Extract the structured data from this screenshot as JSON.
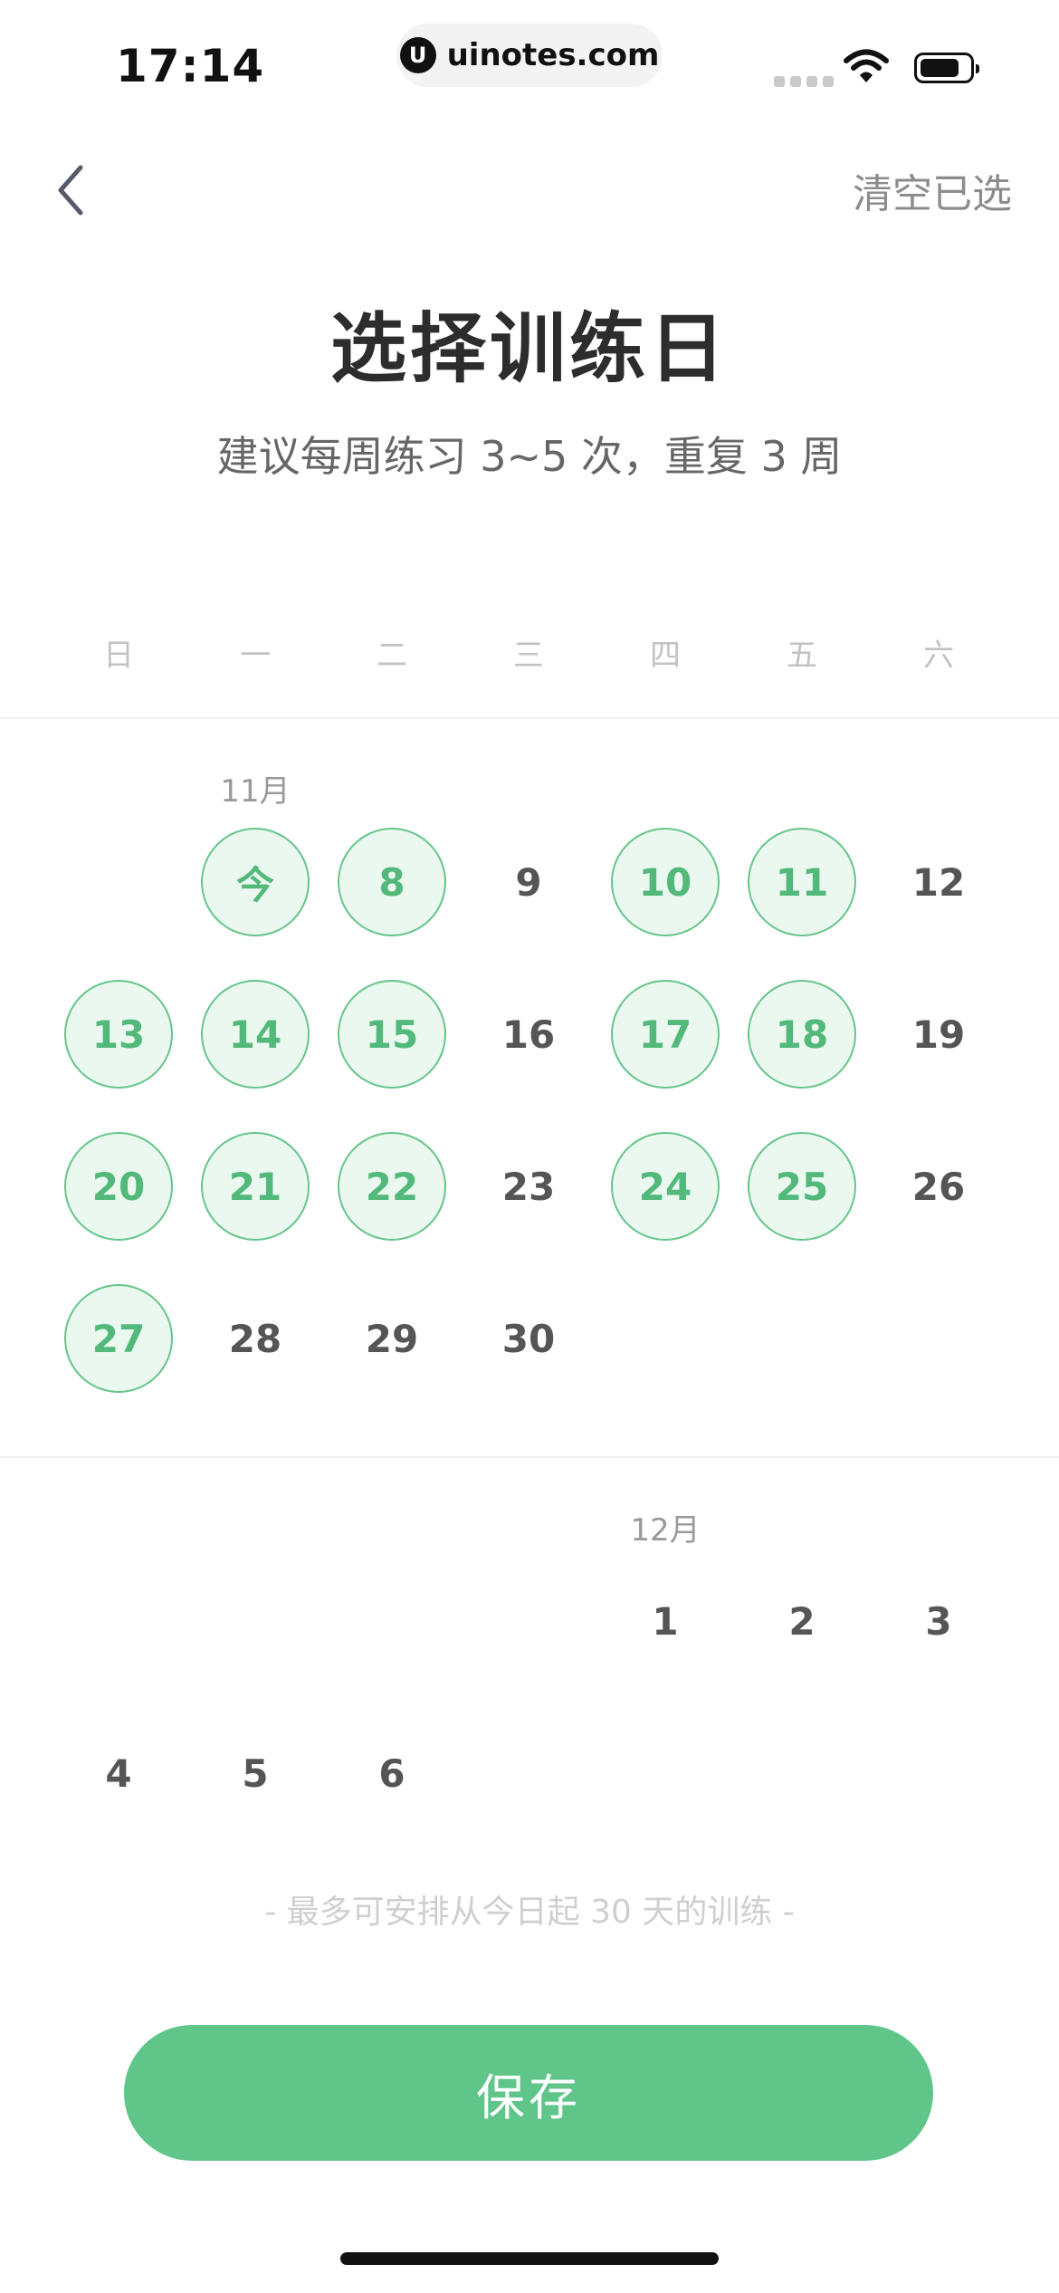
{
  "status_bar": {
    "time": "17:14",
    "url": "uinotes.com",
    "url_logo": "U"
  },
  "header": {
    "clear_label": "清空已选"
  },
  "title": "选择训练日",
  "subtitle": "建议每周练习 3~5 次，重复 3 周",
  "weekdays": [
    "日",
    "一",
    "二",
    "三",
    "四",
    "五",
    "六"
  ],
  "months": [
    {
      "label": "11月",
      "days": [
        {
          "label": "今",
          "selected": true
        },
        {
          "label": "8",
          "selected": true
        },
        {
          "label": "9",
          "selected": false
        },
        {
          "label": "10",
          "selected": true
        },
        {
          "label": "11",
          "selected": true
        },
        {
          "label": "12",
          "selected": false
        },
        {
          "label": "13",
          "selected": true
        },
        {
          "label": "14",
          "selected": true
        },
        {
          "label": "15",
          "selected": true
        },
        {
          "label": "16",
          "selected": false
        },
        {
          "label": "17",
          "selected": true
        },
        {
          "label": "18",
          "selected": true
        },
        {
          "label": "19",
          "selected": false
        },
        {
          "label": "20",
          "selected": true
        },
        {
          "label": "21",
          "selected": true
        },
        {
          "label": "22",
          "selected": true
        },
        {
          "label": "23",
          "selected": false
        },
        {
          "label": "24",
          "selected": true
        },
        {
          "label": "25",
          "selected": true
        },
        {
          "label": "26",
          "selected": false
        },
        {
          "label": "27",
          "selected": true
        },
        {
          "label": "28",
          "selected": false
        },
        {
          "label": "29",
          "selected": false
        },
        {
          "label": "30",
          "selected": false
        }
      ]
    },
    {
      "label": "12月",
      "days": [
        {
          "label": "1",
          "selected": false
        },
        {
          "label": "2",
          "selected": false
        },
        {
          "label": "3",
          "selected": false
        },
        {
          "label": "4",
          "selected": false
        },
        {
          "label": "5",
          "selected": false
        },
        {
          "label": "6",
          "selected": false
        }
      ]
    }
  ],
  "footer_note": "- 最多可安排从今日起 30 天的训练 -",
  "save_label": "保存",
  "colors": {
    "accent": "#5fc589",
    "selected_fill": "#eaf8ef",
    "selected_text": "#52b97b"
  },
  "icons": {
    "back": "chevron-left-icon",
    "wifi": "wifi-icon",
    "battery": "battery-icon"
  }
}
